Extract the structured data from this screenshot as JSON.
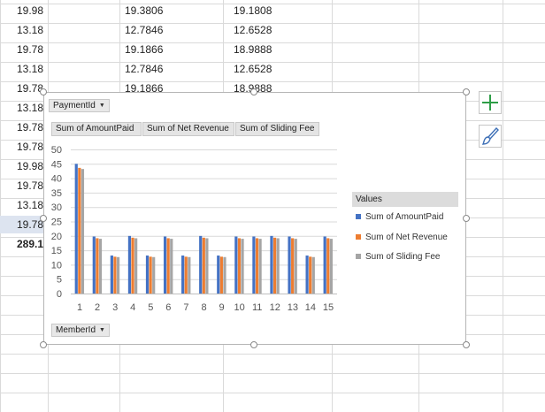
{
  "sheet": {
    "rows": [
      {
        "a": "19.98",
        "b": "19.3806",
        "c": "19.1808"
      },
      {
        "a": "13.18",
        "b": "12.7846",
        "c": "12.6528"
      },
      {
        "a": "19.78",
        "b": "19.1866",
        "c": "18.9888"
      },
      {
        "a": "13.18",
        "b": "12.7846",
        "c": "12.6528"
      },
      {
        "a": "19.78",
        "b": "19.1866",
        "c": "18.9888"
      },
      {
        "a": "13.18",
        "b": "",
        "c": ""
      },
      {
        "a": "19.78",
        "b": "",
        "c": ""
      },
      {
        "a": "19.78",
        "b": "",
        "c": ""
      },
      {
        "a": "19.98",
        "b": "",
        "c": ""
      },
      {
        "a": "19.78",
        "b": "",
        "c": ""
      },
      {
        "a": "13.18",
        "b": "",
        "c": ""
      },
      {
        "a": "19.78",
        "b": "",
        "c": ""
      },
      {
        "a": "289.1",
        "b": "",
        "c": ""
      }
    ]
  },
  "chart": {
    "filter_button": "PaymentId",
    "axis_field_button": "MemberId",
    "value_buttons": [
      "Sum of AmountPaid",
      "Sum of Net Revenue",
      "Sum of Sliding Fee"
    ],
    "legend_title": "Values"
  },
  "side_buttons": {
    "add_icon": "plus-icon",
    "style_icon": "paintbrush-icon"
  },
  "chart_data": {
    "type": "bar",
    "categories": [
      "1",
      "2",
      "3",
      "4",
      "5",
      "6",
      "7",
      "8",
      "9",
      "10",
      "11",
      "12",
      "13",
      "14",
      "15"
    ],
    "series": [
      {
        "name": "Sum of AmountPaid",
        "color": "#4472c4",
        "values": [
          45,
          19.78,
          13.18,
          19.98,
          13.18,
          19.78,
          13.18,
          19.98,
          13.18,
          19.78,
          19.78,
          19.98,
          19.78,
          13.18,
          19.78
        ]
      },
      {
        "name": "Sum of Net Revenue",
        "color": "#ed7d31",
        "values": [
          43.6,
          19.19,
          12.78,
          19.38,
          12.78,
          19.19,
          12.78,
          19.38,
          12.78,
          19.19,
          19.19,
          19.38,
          19.19,
          12.78,
          19.19
        ]
      },
      {
        "name": "Sum of Sliding Fee",
        "color": "#a5a5a5",
        "values": [
          43.2,
          18.99,
          12.65,
          19.18,
          12.65,
          18.99,
          12.65,
          19.18,
          12.65,
          18.99,
          18.99,
          19.18,
          18.99,
          12.65,
          18.99
        ]
      }
    ],
    "ylim": [
      0,
      50
    ],
    "yticks": [
      0,
      5,
      10,
      15,
      20,
      25,
      30,
      35,
      40,
      45,
      50
    ],
    "grid": true,
    "legend_position": "right"
  }
}
